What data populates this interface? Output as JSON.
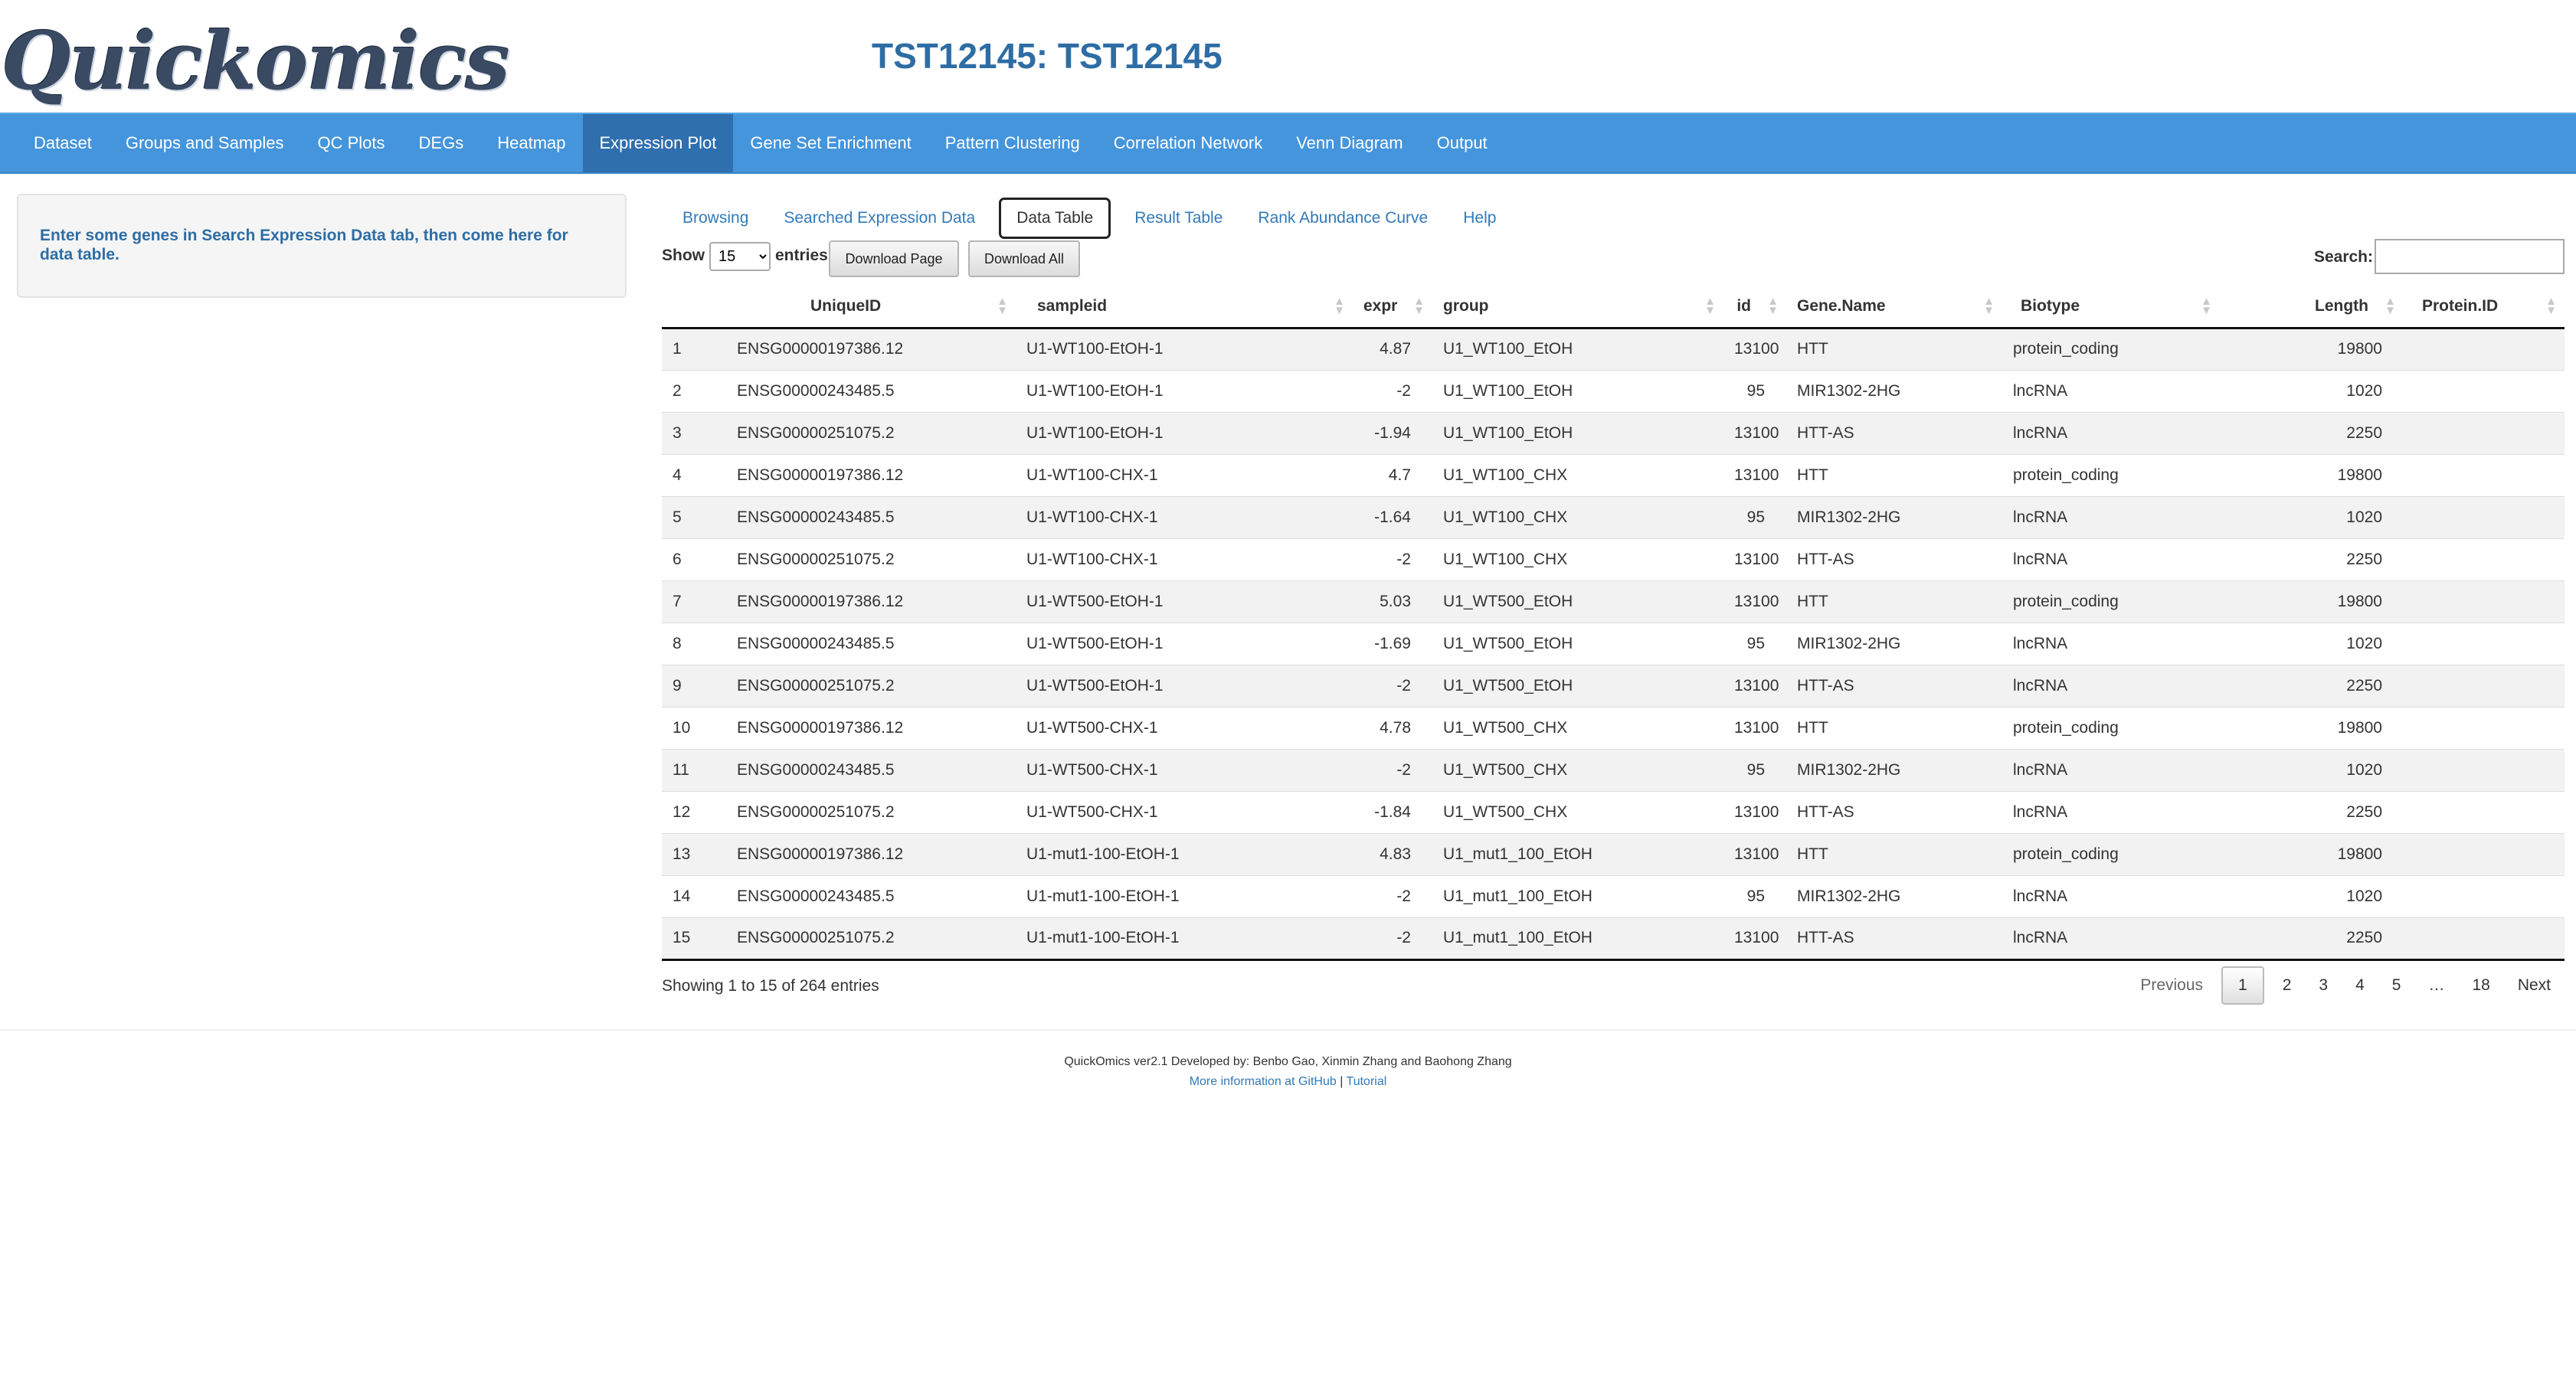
{
  "header": {
    "logo": "Quickomics",
    "title": "TST12145: TST12145"
  },
  "nav": [
    {
      "label": "Dataset"
    },
    {
      "label": "Groups and Samples"
    },
    {
      "label": "QC Plots"
    },
    {
      "label": "DEGs"
    },
    {
      "label": "Heatmap"
    },
    {
      "label": "Expression Plot",
      "active": true
    },
    {
      "label": "Gene Set Enrichment"
    },
    {
      "label": "Pattern Clustering"
    },
    {
      "label": "Correlation Network"
    },
    {
      "label": "Venn Diagram"
    },
    {
      "label": "Output"
    }
  ],
  "sidebar": {
    "message": "Enter some genes in Search Expression Data tab, then come here for data table."
  },
  "tabs": [
    {
      "label": "Browsing"
    },
    {
      "label": "Searched Expression Data"
    },
    {
      "label": "Data Table",
      "active": true
    },
    {
      "label": "Result Table"
    },
    {
      "label": "Rank Abundance Curve"
    },
    {
      "label": "Help"
    }
  ],
  "controls": {
    "show_label": "Show",
    "entries_value": "15",
    "entries_label": "entries",
    "download_page": "Download Page",
    "download_all": "Download All",
    "search_label": "Search:",
    "search_value": ""
  },
  "table": {
    "columns": [
      "",
      "UniqueID",
      "sampleid",
      "expr",
      "group",
      "id",
      "Gene.Name",
      "Biotype",
      "Length",
      "Protein.ID"
    ],
    "rows": [
      [
        "1",
        "ENSG00000197386.12",
        "U1-WT100-EtOH-1",
        "4.87",
        "U1_WT100_EtOH",
        "13100",
        "HTT",
        "protein_coding",
        "19800",
        ""
      ],
      [
        "2",
        "ENSG00000243485.5",
        "U1-WT100-EtOH-1",
        "-2",
        "U1_WT100_EtOH",
        "95",
        "MIR1302-2HG",
        "lncRNA",
        "1020",
        ""
      ],
      [
        "3",
        "ENSG00000251075.2",
        "U1-WT100-EtOH-1",
        "-1.94",
        "U1_WT100_EtOH",
        "13100",
        "HTT-AS",
        "lncRNA",
        "2250",
        ""
      ],
      [
        "4",
        "ENSG00000197386.12",
        "U1-WT100-CHX-1",
        "4.7",
        "U1_WT100_CHX",
        "13100",
        "HTT",
        "protein_coding",
        "19800",
        ""
      ],
      [
        "5",
        "ENSG00000243485.5",
        "U1-WT100-CHX-1",
        "-1.64",
        "U1_WT100_CHX",
        "95",
        "MIR1302-2HG",
        "lncRNA",
        "1020",
        ""
      ],
      [
        "6",
        "ENSG00000251075.2",
        "U1-WT100-CHX-1",
        "-2",
        "U1_WT100_CHX",
        "13100",
        "HTT-AS",
        "lncRNA",
        "2250",
        ""
      ],
      [
        "7",
        "ENSG00000197386.12",
        "U1-WT500-EtOH-1",
        "5.03",
        "U1_WT500_EtOH",
        "13100",
        "HTT",
        "protein_coding",
        "19800",
        ""
      ],
      [
        "8",
        "ENSG00000243485.5",
        "U1-WT500-EtOH-1",
        "-1.69",
        "U1_WT500_EtOH",
        "95",
        "MIR1302-2HG",
        "lncRNA",
        "1020",
        ""
      ],
      [
        "9",
        "ENSG00000251075.2",
        "U1-WT500-EtOH-1",
        "-2",
        "U1_WT500_EtOH",
        "13100",
        "HTT-AS",
        "lncRNA",
        "2250",
        ""
      ],
      [
        "10",
        "ENSG00000197386.12",
        "U1-WT500-CHX-1",
        "4.78",
        "U1_WT500_CHX",
        "13100",
        "HTT",
        "protein_coding",
        "19800",
        ""
      ],
      [
        "11",
        "ENSG00000243485.5",
        "U1-WT500-CHX-1",
        "-2",
        "U1_WT500_CHX",
        "95",
        "MIR1302-2HG",
        "lncRNA",
        "1020",
        ""
      ],
      [
        "12",
        "ENSG00000251075.2",
        "U1-WT500-CHX-1",
        "-1.84",
        "U1_WT500_CHX",
        "13100",
        "HTT-AS",
        "lncRNA",
        "2250",
        ""
      ],
      [
        "13",
        "ENSG00000197386.12",
        "U1-mut1-100-EtOH-1",
        "4.83",
        "U1_mut1_100_EtOH",
        "13100",
        "HTT",
        "protein_coding",
        "19800",
        ""
      ],
      [
        "14",
        "ENSG00000243485.5",
        "U1-mut1-100-EtOH-1",
        "-2",
        "U1_mut1_100_EtOH",
        "95",
        "MIR1302-2HG",
        "lncRNA",
        "1020",
        ""
      ],
      [
        "15",
        "ENSG00000251075.2",
        "U1-mut1-100-EtOH-1",
        "-2",
        "U1_mut1_100_EtOH",
        "13100",
        "HTT-AS",
        "lncRNA",
        "2250",
        ""
      ]
    ]
  },
  "info": "Showing 1 to 15 of 264 entries",
  "pagination": [
    "Previous",
    "1",
    "2",
    "3",
    "4",
    "5",
    "…",
    "18",
    "Next"
  ],
  "footer": {
    "credits": "QuickOmics ver2.1 Developed by: Benbo Gao, Xinmin Zhang and Baohong Zhang",
    "github_link": "More information at GitHub",
    "separator": " | ",
    "tutorial_link": "Tutorial"
  },
  "colors": {
    "navbar": "#4495dc",
    "navbar_active": "#2f6fae",
    "title": "#2e6da4",
    "link": "#337ab7"
  }
}
